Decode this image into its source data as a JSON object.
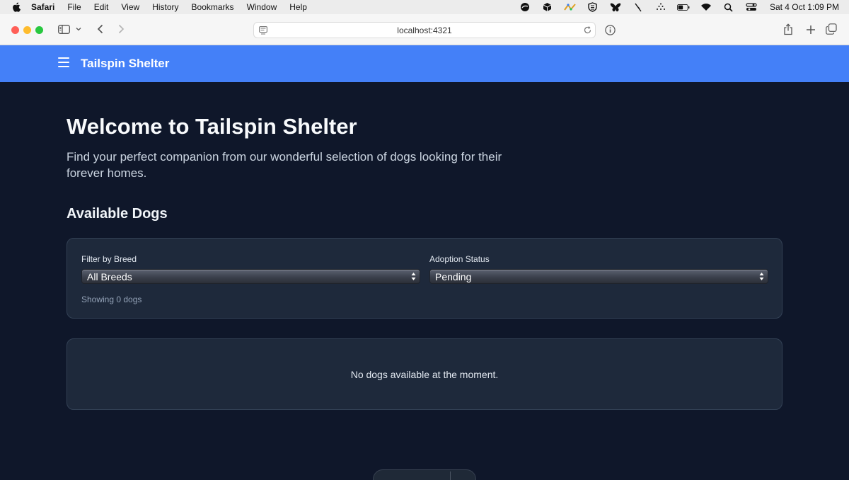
{
  "menubar": {
    "app_name": "Safari",
    "items": [
      "File",
      "Edit",
      "View",
      "History",
      "Bookmarks",
      "Window",
      "Help"
    ],
    "clock": "Sat 4 Oct  1:09 PM",
    "status_icons": [
      "vpn-icon",
      "box-icon",
      "flow-icon",
      "shield-icon",
      "butterfly-icon",
      "slash-icon",
      "dots-icon",
      "battery-icon",
      "wifi-icon",
      "spotlight-icon",
      "control-center-icon"
    ]
  },
  "browser": {
    "url": "localhost:4321"
  },
  "app": {
    "title": "Tailspin Shelter",
    "accent_color": "#4480f8",
    "background_color": "#0f172a"
  },
  "hero": {
    "title": "Welcome to Tailspin Shelter",
    "subtitle": "Find your perfect companion from our wonderful selection of dogs looking for their forever homes."
  },
  "dogs_section": {
    "title": "Available Dogs",
    "filters": {
      "breed_label": "Filter by Breed",
      "breed_selected": "All Breeds",
      "status_label": "Adoption Status",
      "status_selected": "Pending"
    },
    "count_text": "Showing 0 dogs",
    "empty_message": "No dogs available at the moment."
  }
}
